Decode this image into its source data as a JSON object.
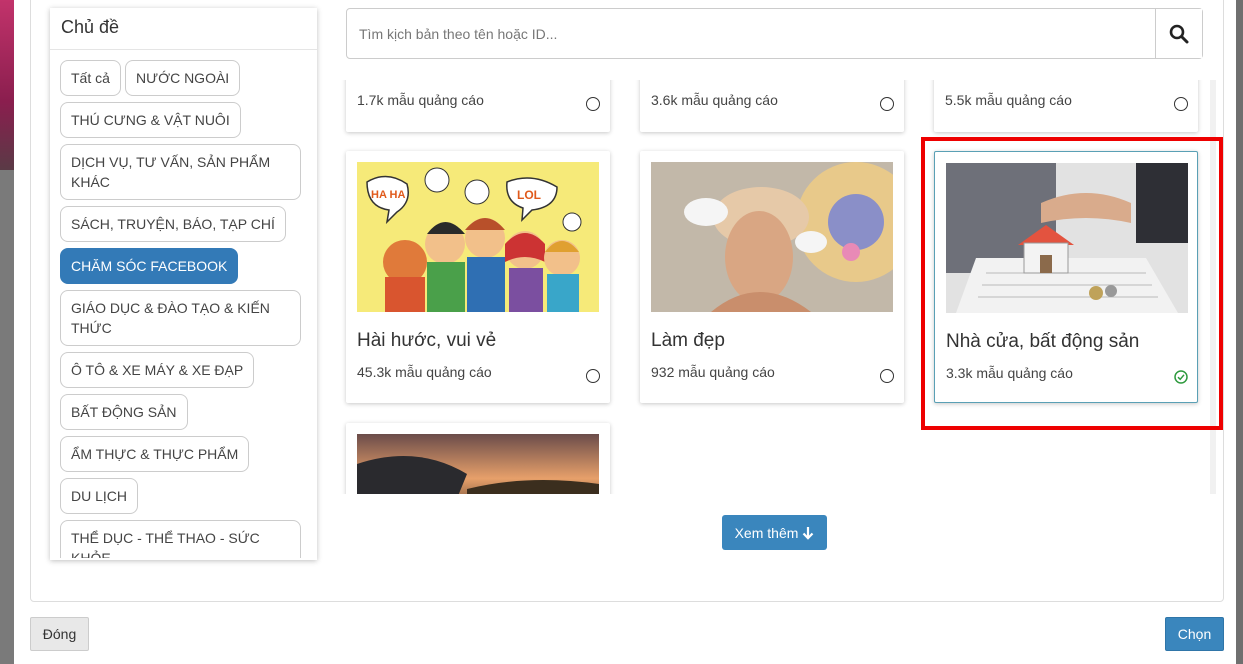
{
  "sidebar": {
    "title": "Chủ đề",
    "tags": [
      {
        "label": "Tất cả"
      },
      {
        "label": "NƯỚC NGOÀI"
      },
      {
        "label": "THÚ CƯNG & VẬT NUÔI"
      },
      {
        "label": "DỊCH VỤ, TƯ VẤN, SẢN PHẨM KHÁC"
      },
      {
        "label": "SÁCH, TRUYỆN, BÁO, TẠP CHÍ"
      },
      {
        "label": "CHĂM SÓC FACEBOOK",
        "active": true
      },
      {
        "label": "GIÁO DỤC & ĐÀO TẠO & KIẾN THỨC"
      },
      {
        "label": "Ô TÔ & XE MÁY & XE ĐẠP"
      },
      {
        "label": "BẤT ĐỘNG SẢN"
      },
      {
        "label": "ẨM THỰC & THỰC PHẨM"
      },
      {
        "label": "DU LỊCH"
      },
      {
        "label": "THỂ DỤC - THỂ THAO - SỨC KHỎE"
      }
    ]
  },
  "search": {
    "placeholder": "Tìm kịch bản theo tên hoặc ID..."
  },
  "cards": [
    {
      "count": "1.7k mẫu quảng cáo",
      "selected": false
    },
    {
      "count": "3.6k mẫu quảng cáo",
      "selected": false
    },
    {
      "count": "5.5k mẫu quảng cáo",
      "selected": false
    },
    {
      "title": "Hài hước, vui vẻ",
      "count": "45.3k mẫu quảng cáo",
      "selected": false
    },
    {
      "title": "Làm đẹp",
      "count": "932 mẫu quảng cáo",
      "selected": false
    },
    {
      "title": "Nhà cửa, bất động sản",
      "count": "3.3k mẫu quảng cáo",
      "selected": true
    }
  ],
  "comic_text": {
    "ha": "HA HA",
    "lol": "LOL"
  },
  "more_button": {
    "label": "Xem thêm"
  },
  "footer": {
    "close_label": "Đóng",
    "choose_label": "Chọn"
  },
  "colors": {
    "accent": "#3a86bd",
    "active_tag": "#337ab7",
    "highlight": "#ee0000",
    "check": "#2e9a3e"
  }
}
